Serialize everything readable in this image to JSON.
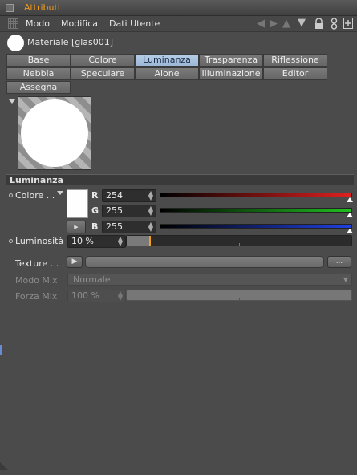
{
  "window": {
    "title": "Attributi"
  },
  "menu": {
    "items": [
      "Modo",
      "Modifica",
      "Dati Utente"
    ]
  },
  "toolbar": {
    "icons": [
      "arrow-left-icon",
      "arrow-right-icon",
      "arrow-up-icon",
      "lock-icon",
      "link-icon",
      "add-panel-icon"
    ]
  },
  "material": {
    "name": "Materiale [glas001]"
  },
  "tabs": [
    {
      "label": "Base",
      "active": false
    },
    {
      "label": "Colore",
      "active": false
    },
    {
      "label": "Luminanza",
      "active": true
    },
    {
      "label": "Trasparenza",
      "active": false
    },
    {
      "label": "Riflessione",
      "active": false
    },
    {
      "label": "Nebbia",
      "active": false
    },
    {
      "label": "Speculare",
      "active": false
    },
    {
      "label": "Alone",
      "active": false
    },
    {
      "label": "Illuminazione",
      "active": false
    },
    {
      "label": "Editor",
      "active": false
    },
    {
      "label": "Assegna",
      "active": false
    }
  ],
  "section": {
    "title": "Luminanza"
  },
  "color": {
    "label": "Colore . .",
    "swatch_color": "#fefefe",
    "channels": [
      {
        "name": "R",
        "value": "254",
        "color": "#e02020"
      },
      {
        "name": "G",
        "value": "255",
        "color": "#20c020"
      },
      {
        "name": "B",
        "value": "255",
        "color": "#2040e0"
      }
    ]
  },
  "luminosity": {
    "label": "Luminosità",
    "value": "10 %",
    "fraction": 0.1,
    "accent": "#f0a020"
  },
  "texture": {
    "label": "Texture . . . .",
    "browse_label": "..."
  },
  "mix_mode": {
    "label": "Modo Mix",
    "value": "Normale"
  },
  "mix_strength": {
    "label": "Forza Mix",
    "value": "100 %"
  }
}
